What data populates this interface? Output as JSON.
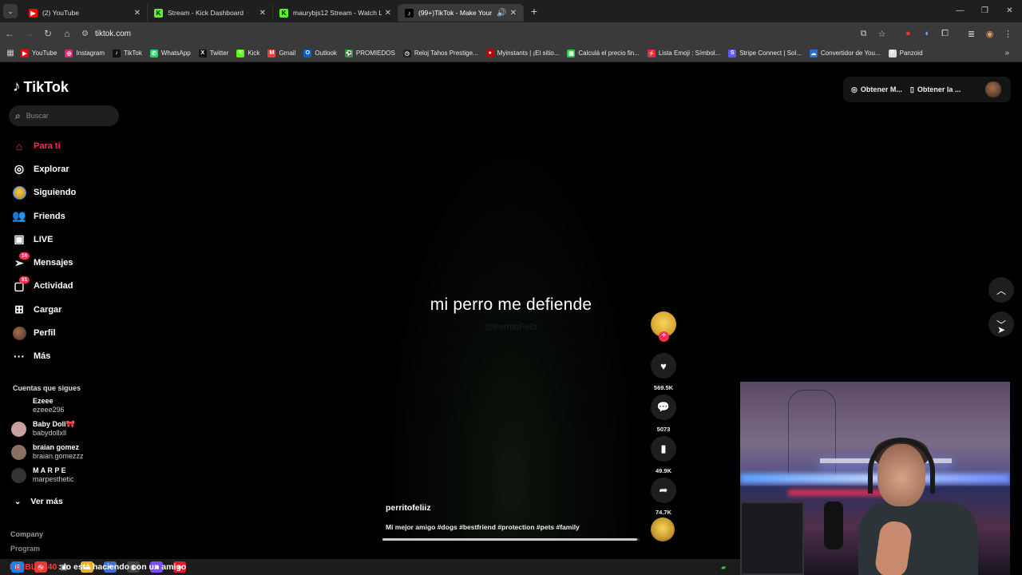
{
  "browser": {
    "tabs": [
      {
        "title": "(2) YouTube",
        "favicon": "youtube-icon",
        "color": "#ff0000",
        "active": false
      },
      {
        "title": "Stream - Kick Dashboard",
        "favicon": "kick-icon",
        "color": "#53fc18",
        "active": false
      },
      {
        "title": "maurybjs12 Stream - Watch Liv",
        "favicon": "kick-icon",
        "color": "#53fc18",
        "active": false
      },
      {
        "title": "(99+)TikTok - Make Your Da",
        "favicon": "tiktok-icon",
        "color": "#ffffff",
        "active": true
      }
    ],
    "new_tab": "+",
    "address": "tiktok.com",
    "bookmarks": [
      {
        "label": "YouTube",
        "color": "#ff0000",
        "glyph": "▶"
      },
      {
        "label": "Instagram",
        "color": "#d62976",
        "glyph": "◎"
      },
      {
        "label": "TikTok",
        "color": "#111111",
        "glyph": "♪"
      },
      {
        "label": "WhatsApp",
        "color": "#25d366",
        "glyph": "✆"
      },
      {
        "label": "Twitter",
        "color": "#111111",
        "glyph": "X"
      },
      {
        "label": "Kick",
        "color": "#53fc18",
        "glyph": "K"
      },
      {
        "label": "Gmail",
        "color": "#ea4335",
        "glyph": "M"
      },
      {
        "label": "Outlook",
        "color": "#0a64c8",
        "glyph": "O"
      },
      {
        "label": "PROMIEDOS",
        "color": "#2e9b3a",
        "glyph": "⚽"
      },
      {
        "label": "Reloj Tahos Prestige...",
        "color": "#222222",
        "glyph": "◷"
      },
      {
        "label": "Myinstants | ¡El sitio...",
        "color": "#c00000",
        "glyph": "●"
      },
      {
        "label": "Calculá el precio fin...",
        "color": "#2ecc40",
        "glyph": "▦"
      },
      {
        "label": "Lista Emoji : Símbol...",
        "color": "#e0245e",
        "glyph": "⚡"
      },
      {
        "label": "Stripe Connect | Sol...",
        "color": "#635bff",
        "glyph": "S"
      },
      {
        "label": "Convertidor de You...",
        "color": "#2a6cd6",
        "glyph": "☁"
      },
      {
        "label": "Panzoid",
        "color": "#dddddd",
        "glyph": "P"
      }
    ]
  },
  "tiktok": {
    "logo": "TikTok",
    "search_placeholder": "Buscar",
    "nav": [
      {
        "label": "Para ti",
        "icon": "home-icon",
        "glyph": "⌂",
        "active": true
      },
      {
        "label": "Explorar",
        "icon": "compass-icon",
        "glyph": "◎"
      },
      {
        "label": "Siguiendo",
        "icon": "following-avatar-icon",
        "glyph": ""
      },
      {
        "label": "Friends",
        "icon": "friends-icon",
        "glyph": "👥"
      },
      {
        "label": "LIVE",
        "icon": "live-icon",
        "glyph": "▣"
      },
      {
        "label": "Mensajes",
        "icon": "messages-icon",
        "glyph": "➢",
        "badge": "16"
      },
      {
        "label": "Actividad",
        "icon": "activity-icon",
        "glyph": "▢",
        "badge": "91"
      },
      {
        "label": "Cargar",
        "icon": "upload-icon",
        "glyph": "⊞"
      },
      {
        "label": "Perfil",
        "icon": "profile-avatar-icon",
        "glyph": ""
      },
      {
        "label": "Más",
        "icon": "more-icon",
        "glyph": "···"
      }
    ],
    "following_title": "Cuentas que sigues",
    "following": [
      {
        "name": "Ezeee",
        "handle": "ezeee296",
        "color": "#000000"
      },
      {
        "name": "Baby Doll🎀",
        "handle": "babydollxll",
        "color": "#c9a0a0"
      },
      {
        "name": "braian gomez",
        "handle": "braian.gomezzz",
        "color": "#8a7060"
      },
      {
        "name": "M A R P E",
        "handle": "marpesthetic",
        "color": "#333333"
      }
    ],
    "ver_mas": "Ver más",
    "company": "Company",
    "program": "Program",
    "top_right": {
      "button1": "Obtener M...",
      "button2": "Obtener la ..."
    },
    "video": {
      "caption": "mi perro me defiende",
      "watermark": "@PerritoFeliz",
      "author": "perritofeliiz",
      "description": "Mi mejor amigo #dogs #bestfriend #protection #pets #family",
      "progress": 0.99
    },
    "actions": {
      "likes": "569.5K",
      "comments": "5073",
      "saves": "49.9K",
      "shares": "74.7K"
    }
  },
  "stream_overlay": {
    "chat_user": "I 1HBL 2340",
    "chat_message": ": lo está haciendo con un amigo"
  }
}
